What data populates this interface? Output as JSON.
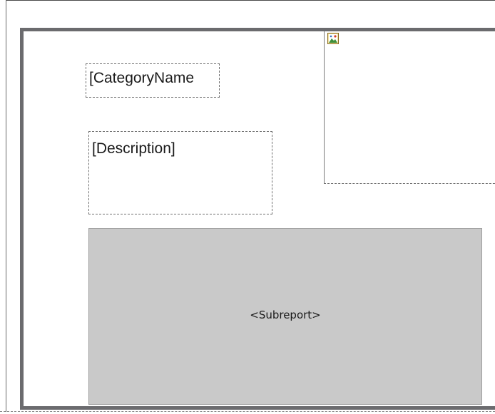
{
  "report": {
    "controls": {
      "category_name": "[CategoryName",
      "description": "[Description]",
      "subreport": "<Subreport>"
    },
    "image_control": {
      "icon": "image-placeholder-icon"
    }
  },
  "colors": {
    "section_border": "#6b6b6e",
    "subreport_fill": "#c9c9c9",
    "control_border": "#6f6f6f"
  }
}
